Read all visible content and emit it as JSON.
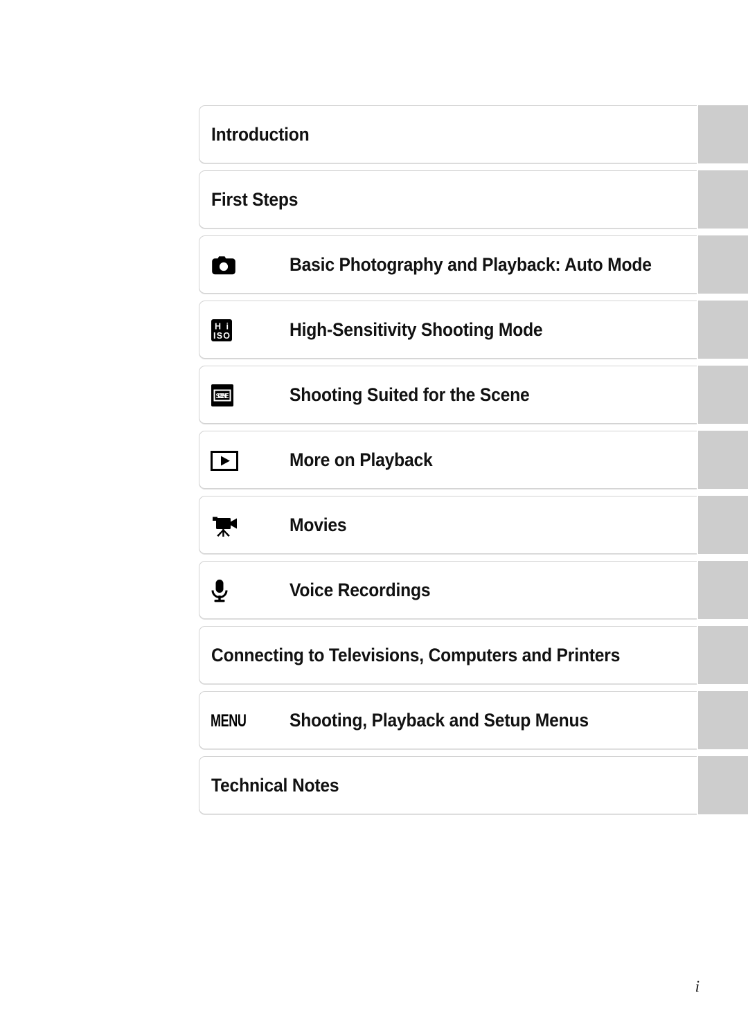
{
  "page": {
    "folio": "i"
  },
  "toc": {
    "rows": [
      {
        "icon": "none",
        "title": "Introduction"
      },
      {
        "icon": "none",
        "title": "First Steps"
      },
      {
        "icon": "camera-icon",
        "title": "Basic Photography and Playback: Auto Mode"
      },
      {
        "icon": "hi-iso-icon",
        "title": "High-Sensitivity Shooting Mode"
      },
      {
        "icon": "scene-icon",
        "title": "Shooting Suited for the Scene"
      },
      {
        "icon": "play-icon",
        "title": "More on Playback"
      },
      {
        "icon": "movie-icon",
        "title": "Movies"
      },
      {
        "icon": "microphone-icon",
        "title": "Voice Recordings"
      },
      {
        "icon": "none",
        "title": "Connecting to Televisions, Computers and Printers"
      },
      {
        "icon": "menu-icon",
        "title": "Shooting, Playback and Setup Menus",
        "icon_label": "MENU"
      },
      {
        "icon": "none",
        "title": "Technical Notes"
      }
    ]
  },
  "colors": {
    "tab_gray": "#cdcdcd",
    "card_border": "#d3d3d3",
    "text": "#111111",
    "page_background": "#ffffff"
  }
}
